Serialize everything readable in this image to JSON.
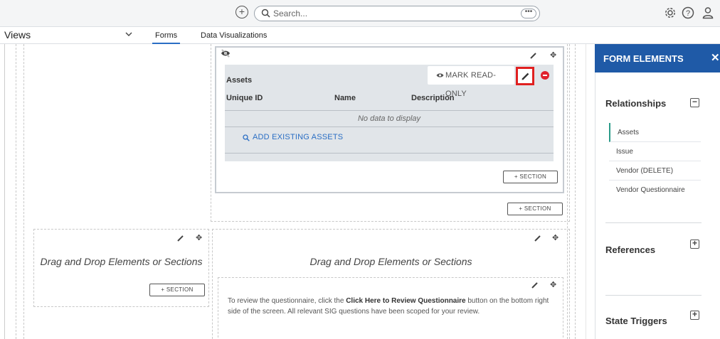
{
  "topbar": {
    "search_placeholder": "Search...",
    "more_label": "•••"
  },
  "navbar": {
    "views_label": "Views",
    "tabs": [
      {
        "label": "Forms",
        "active": true
      },
      {
        "label": "Data Visualizations",
        "active": false
      }
    ]
  },
  "canvas": {
    "section_button_label": "+ SECTION",
    "dnd_left": "Drag and Drop Elements or Sections",
    "dnd_right": "Drag and Drop Elements or Sections",
    "assets": {
      "title": "Assets",
      "mark_read_only": "MARK READ-ONLY",
      "columns": [
        "Unique ID",
        "Name",
        "Description"
      ],
      "empty_text": "No data to display",
      "add_existing": "ADD EXISTING ASSETS"
    },
    "info": {
      "before": "To review the questionnaire, click the ",
      "bold": "Click Here to Review Questionnaire",
      "after": " button on the bottom right side of the screen. All relevant SIG questions have been scoped for your review."
    }
  },
  "panel": {
    "title": "FORM ELEMENTS",
    "close": "✕",
    "groups": [
      {
        "title": "Relationships",
        "toggle": "−",
        "items": [
          "Assets",
          "Issue",
          "Vendor (DELETE)",
          "Vendor Questionnaire"
        ],
        "selected": "Assets"
      },
      {
        "title": "References",
        "toggle": "+"
      },
      {
        "title": "State Triggers",
        "toggle": "+"
      }
    ]
  },
  "colors": {
    "accent": "#1f5aa7",
    "highlight_border": "#e02020",
    "remove": "#e0222e",
    "selected_marker": "#2b9b8a",
    "link": "#2a6ec4"
  },
  "icons": [
    "add-circle-icon",
    "search-icon",
    "gear-icon",
    "help-icon",
    "user-icon",
    "chevron-down-icon",
    "eye-slash-icon",
    "pencil-icon",
    "move-icon",
    "eye-icon",
    "minus-circle-icon",
    "close-icon"
  ]
}
